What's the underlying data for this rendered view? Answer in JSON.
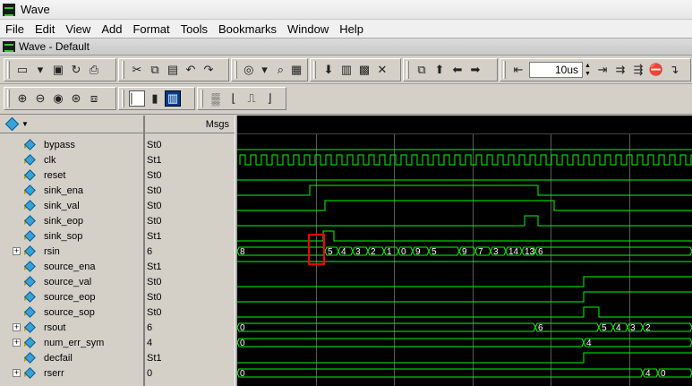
{
  "window": {
    "title": "Wave"
  },
  "menu": [
    "File",
    "Edit",
    "View",
    "Add",
    "Format",
    "Tools",
    "Bookmarks",
    "Window",
    "Help"
  ],
  "pane": {
    "title": "Wave - Default"
  },
  "toolbar": {
    "zoom_value": "10us"
  },
  "value_header": "Msgs",
  "colors": {
    "wave": "#00ff00",
    "background": "#000000",
    "highlight_box": "#ff0000"
  },
  "signals": [
    {
      "name": "bypass",
      "value": "St0",
      "expandable": false
    },
    {
      "name": "clk",
      "value": "St1",
      "expandable": false
    },
    {
      "name": "reset",
      "value": "St0",
      "expandable": false
    },
    {
      "name": "sink_ena",
      "value": "St0",
      "expandable": false
    },
    {
      "name": "sink_val",
      "value": "St0",
      "expandable": false
    },
    {
      "name": "sink_eop",
      "value": "St0",
      "expandable": false
    },
    {
      "name": "sink_sop",
      "value": "St1",
      "expandable": false
    },
    {
      "name": "rsin",
      "value": "6",
      "expandable": true
    },
    {
      "name": "source_ena",
      "value": "St1",
      "expandable": false
    },
    {
      "name": "source_val",
      "value": "St0",
      "expandable": false
    },
    {
      "name": "source_eop",
      "value": "St0",
      "expandable": false
    },
    {
      "name": "source_sop",
      "value": "St0",
      "expandable": false
    },
    {
      "name": "rsout",
      "value": "6",
      "expandable": true
    },
    {
      "name": "num_err_sym",
      "value": "4",
      "expandable": true
    },
    {
      "name": "decfail",
      "value": "St1",
      "expandable": false
    },
    {
      "name": "rserr",
      "value": "0",
      "expandable": true
    }
  ],
  "bus_labels": {
    "rsin": [
      "8",
      "5",
      "4",
      "3",
      "2",
      "1",
      "0",
      "9",
      "5",
      "9",
      "7",
      "3",
      "14",
      "13",
      "6"
    ],
    "rsout": [
      "0",
      "6",
      "5",
      "4",
      "3",
      "2"
    ],
    "num_err_sym": [
      "0",
      "4"
    ],
    "rserr": [
      "0",
      "4",
      "0"
    ]
  }
}
